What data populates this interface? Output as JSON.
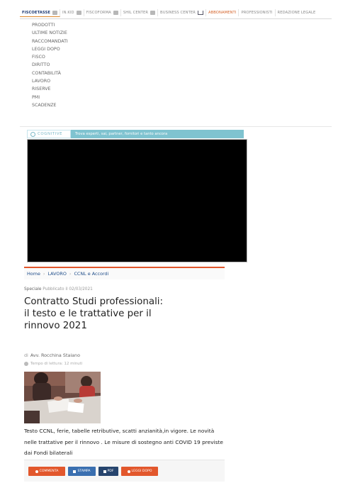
{
  "topbar": {
    "items": [
      {
        "label": "FISCOETASSE",
        "icon": "grid-icon"
      },
      {
        "label": "IN.KID",
        "icon": "grid-icon"
      },
      {
        "label": "FISCOFORMA",
        "icon": "grid-icon"
      },
      {
        "label": "SHIL CENTER",
        "icon": "grid-icon"
      },
      {
        "label": "BUSINESS CENTER",
        "icon": "cart-icon"
      },
      {
        "label": "ABBONAMENTI",
        "icon": ""
      },
      {
        "label": "PROFESSIONISTI",
        "icon": ""
      },
      {
        "label": "REDAZIONE LEGALE",
        "icon": ""
      }
    ]
  },
  "menu": {
    "items": [
      "PRODOTTI",
      "ULTIME NOTIZIE",
      "RACCOMANDATI",
      "LEGGI DOPO",
      "FISCO",
      "DIRITTO",
      "CONTABILITÀ",
      "LAVORO",
      "RISERVE",
      "PMI",
      "SCADENZE"
    ]
  },
  "cognitive": {
    "logo": "COGNITIVE",
    "banner": "Trova esperti, sai, partner, fornitori e tanto ancora"
  },
  "breadcrumb": {
    "home": "Home",
    "section": "LAVORO",
    "subsection": "CCNL e Accordi"
  },
  "article": {
    "category": "Speciale",
    "published": "Pubblicato il 02/03/2021",
    "title": "Contratto Studi professionali: il testo e le trattative per il rinnovo 2021",
    "author_prefix": "di",
    "author": "Avv. Rocchina Staiano",
    "reading_time": "Tempo di lettura: 12 minuti",
    "description": "Testo CCNL, ferie, tabelle retributive, scatti anzianità,in vigore. Le novità nelle trattative per il rinnovo . Le misure di sostegno anti COVID 19 previste dai Fondi bilaterali"
  },
  "actions": {
    "comment": "COMMENTA",
    "print": "STAMPA",
    "pdf": "PDF",
    "read_later": "LEGGI DOPO"
  },
  "colors": {
    "accent_orange": "#e2572c",
    "brand_blue": "#1f4d8a",
    "cognitive_teal": "#7fc3d0",
    "print_blue": "#3a6fb0",
    "pdf_navy": "#27456e"
  }
}
